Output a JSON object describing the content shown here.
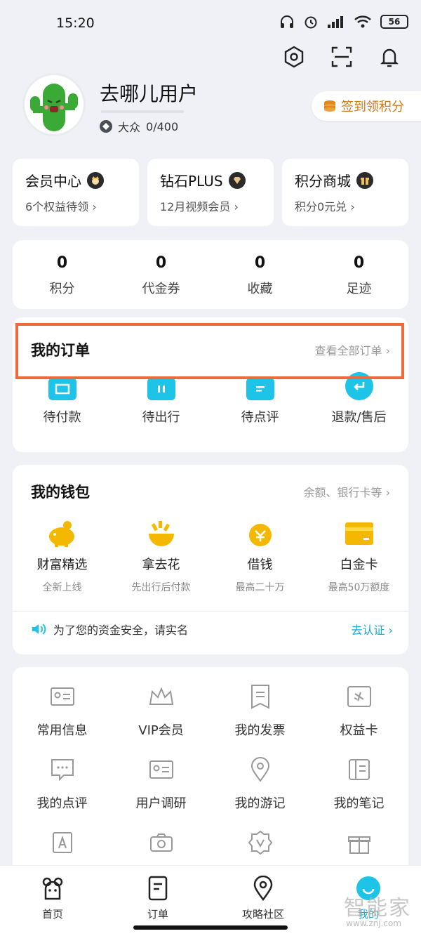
{
  "status_bar": {
    "time": "15:20",
    "battery": "56"
  },
  "profile": {
    "name": "去哪儿用户",
    "level": "大众",
    "points_progress": "0/400"
  },
  "signin": {
    "label": "签到领积分"
  },
  "vip_cards": [
    {
      "title": "会员中心",
      "sub": "6个权益待领 ›"
    },
    {
      "title": "钻石PLUS",
      "sub": "12月视频会员 ›"
    },
    {
      "title": "积分商城",
      "sub": "积分0元兑 ›"
    }
  ],
  "stats": [
    {
      "num": "0",
      "label": "积分"
    },
    {
      "num": "0",
      "label": "代金券"
    },
    {
      "num": "0",
      "label": "收藏"
    },
    {
      "num": "0",
      "label": "足迹"
    }
  ],
  "orders": {
    "title": "我的订单",
    "link": "查看全部订单 ›",
    "items": [
      "待付款",
      "待出行",
      "待点评",
      "退款/售后"
    ]
  },
  "wallet": {
    "title": "我的钱包",
    "link": "余额、银行卡等 ›",
    "items": [
      {
        "name": "财富精选",
        "desc": "全新上线",
        "icon": "piggy-bank-icon"
      },
      {
        "name": "拿去花",
        "desc": "先出行后付款",
        "icon": "flower-icon"
      },
      {
        "name": "借钱",
        "desc": "最高二十万",
        "icon": "loan-icon"
      },
      {
        "name": "白金卡",
        "desc": "最高50万额度",
        "icon": "card-icon"
      }
    ],
    "notice": "为了您的资金安全，请实名",
    "notice_action": "去认证 ›"
  },
  "tools": [
    "常用信息",
    "VIP会员",
    "我的发票",
    "权益卡",
    "我的点评",
    "用户调研",
    "我的游记",
    "我的笔记"
  ],
  "tabbar": [
    "首页",
    "订单",
    "攻略社区",
    "我的"
  ],
  "watermark": {
    "text": "智能家",
    "url": "www.znj.com"
  },
  "colors": {
    "accent": "#1ec3e8",
    "highlight": "#ef6a3b",
    "wallet_icon": "#f5b800"
  }
}
